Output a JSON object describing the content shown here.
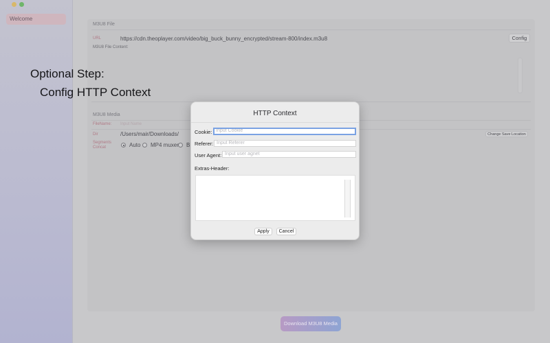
{
  "sidebar": {
    "items": [
      {
        "label": "Welcome"
      }
    ]
  },
  "m3u8_file": {
    "section_title": "M3U8 File",
    "url_label": "URL",
    "url_value": "https://cdn.theoplayer.com/video/big_buck_bunny_encrypted/stream-800/index.m3u8",
    "config_button": "Config",
    "content_label": "M3U8 File Content:"
  },
  "m3u8_media": {
    "section_title": "M3U8 Media",
    "filename_label": "FileName:",
    "filename_placeholder": "Input Name",
    "dir_label": "Dir",
    "dir_value": "/Users/mair/Downloads/",
    "change_button": "Change Save Location",
    "segments_label_1": "Segments",
    "segments_label_2": "Concat",
    "options": [
      {
        "label": "Auto",
        "selected": true
      },
      {
        "label": "MP4 muxer",
        "selected": false
      },
      {
        "label": "B",
        "selected": false
      }
    ]
  },
  "download_button": "Download M3U8 Media",
  "overlay": {
    "line1": "Optional Step:",
    "line2": "Config HTTP Context"
  },
  "dialog": {
    "title": "HTTP Context",
    "cookie_label": "Cookie:",
    "cookie_placeholder": "Input Cookie",
    "referer_label": "Referer:",
    "referer_placeholder": "Input Referer",
    "user_agent_label": "User Agent:",
    "user_agent_placeholder": "Input user agnet",
    "extras_label": "Extras-Header:",
    "apply_button": "Apply",
    "cancel_button": "Cancel"
  },
  "colors": {
    "accent_focus": "#7aa2e3",
    "sidebar_selected": "#cfb6be",
    "download_gradient_start": "#b79ac4",
    "download_gradient_end": "#8ea4d3"
  }
}
